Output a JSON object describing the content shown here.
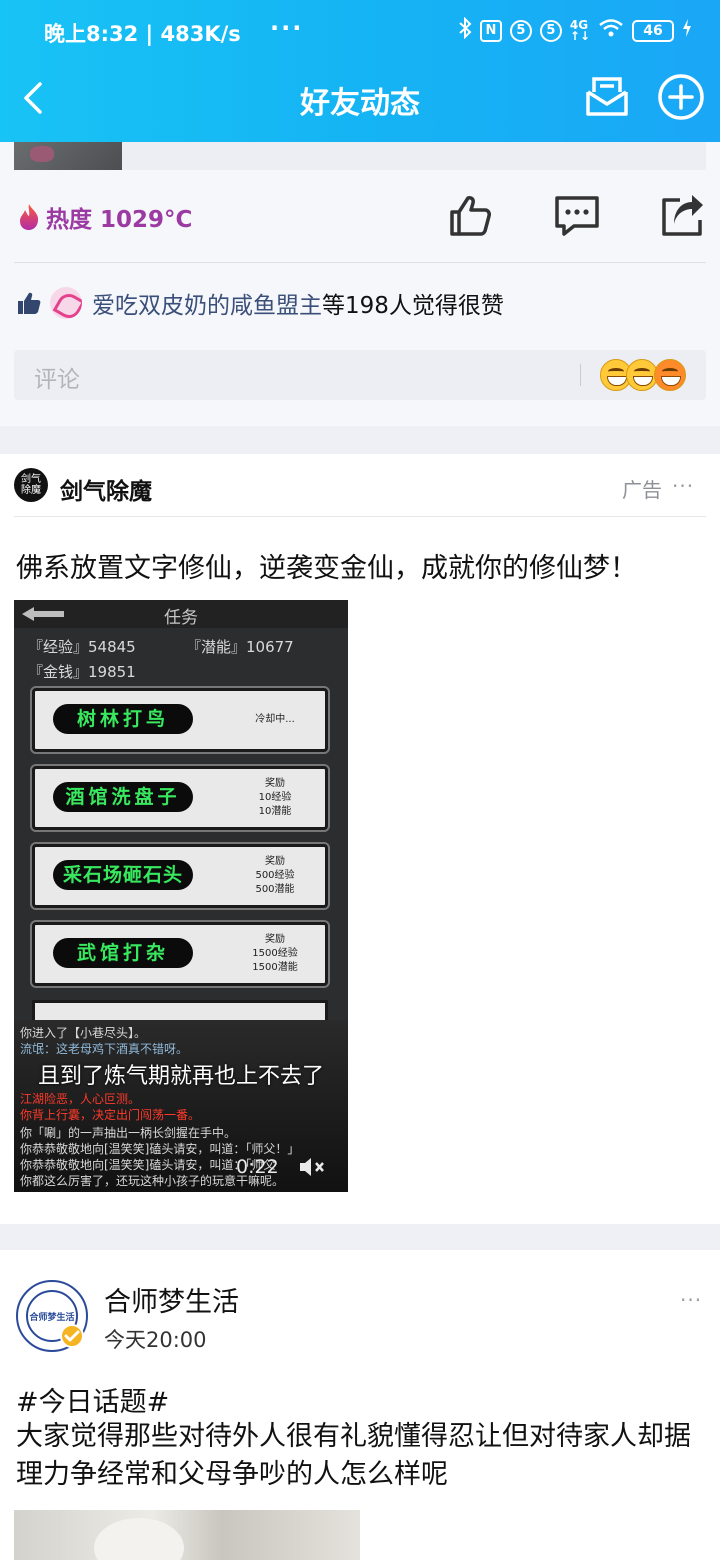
{
  "status_bar": {
    "time_speed": "晚上8:32 | 483K/s",
    "more": "···",
    "battery": "46"
  },
  "nav": {
    "title": "好友动态"
  },
  "prev_post": {
    "heat": "热度 1029°C",
    "likes_name": "爱吃双皮奶的咸鱼盟主",
    "likes_suffix": "等198人觉得很赞",
    "comment_placeholder": "评论"
  },
  "ad_post": {
    "name": "剑气除魔",
    "avatar_text": "剑气除魔",
    "tag": "广告",
    "more": "···",
    "text": "佛系放置文字修仙，逆袭变金仙，成就你的修仙梦！",
    "video": {
      "screen_title": "任务",
      "stats": {
        "exp": "『经验』54845",
        "potential": "『潜能』10677",
        "money": "『金钱』19851"
      },
      "tasks": [
        {
          "name": "树林打鸟",
          "reward": [
            "冷却中..."
          ]
        },
        {
          "name": "酒馆洗盘子",
          "reward": [
            "奖励",
            "10经验",
            "10潜能"
          ]
        },
        {
          "name": "采石场砸石头",
          "reward": [
            "奖励",
            "500经验",
            "500潜能"
          ]
        },
        {
          "name": "武馆打杂",
          "reward": [
            "奖励",
            "1500经验",
            "1500潜能"
          ]
        }
      ],
      "log": [
        {
          "text": "你进入了【小巷尽头】。",
          "color": "#d7d7d7"
        },
        {
          "text": "流氓：这老母鸡下酒真不错呀。",
          "color": "#8fb8d8"
        },
        {
          "text": "江湖险恶，人心叵测。",
          "color": "#ff3a2a"
        },
        {
          "text": "你背上行囊，决定出门闯荡一番。",
          "color": "#ff3a2a"
        },
        {
          "text": "你「唰」的一声抽出一柄长剑握在手中。",
          "color": "#d7d7d7"
        },
        {
          "text": "你恭恭敬敬地向[温笑笑]磕头请安，叫道：「师父！」",
          "color": "#d7d7d7"
        },
        {
          "text": "你恭恭敬敬地向[温笑笑]磕头请安，叫道：「师父",
          "color": "#d7d7d7"
        },
        {
          "text": "你都这么厉害了，还玩这种小孩子的玩意干嘛呢。",
          "color": "#d7d7d7"
        }
      ],
      "subtitle": "且到了炼气期就再也上不去了",
      "time": "0:22"
    }
  },
  "post": {
    "name": "合师梦生活",
    "avatar_text": "合师梦生活",
    "time": "今天20:00",
    "more": "···",
    "topic": "#今日话题#",
    "text": "大家觉得那些对待外人很有礼貌懂得忍让但对待家人却据理力争经常和父母争吵的人怎么样呢"
  },
  "colors": {
    "header": "#15b4f4",
    "heat": "#9a3aa2",
    "link_name": "#3a4f7a",
    "task_text": "#38e85e"
  }
}
